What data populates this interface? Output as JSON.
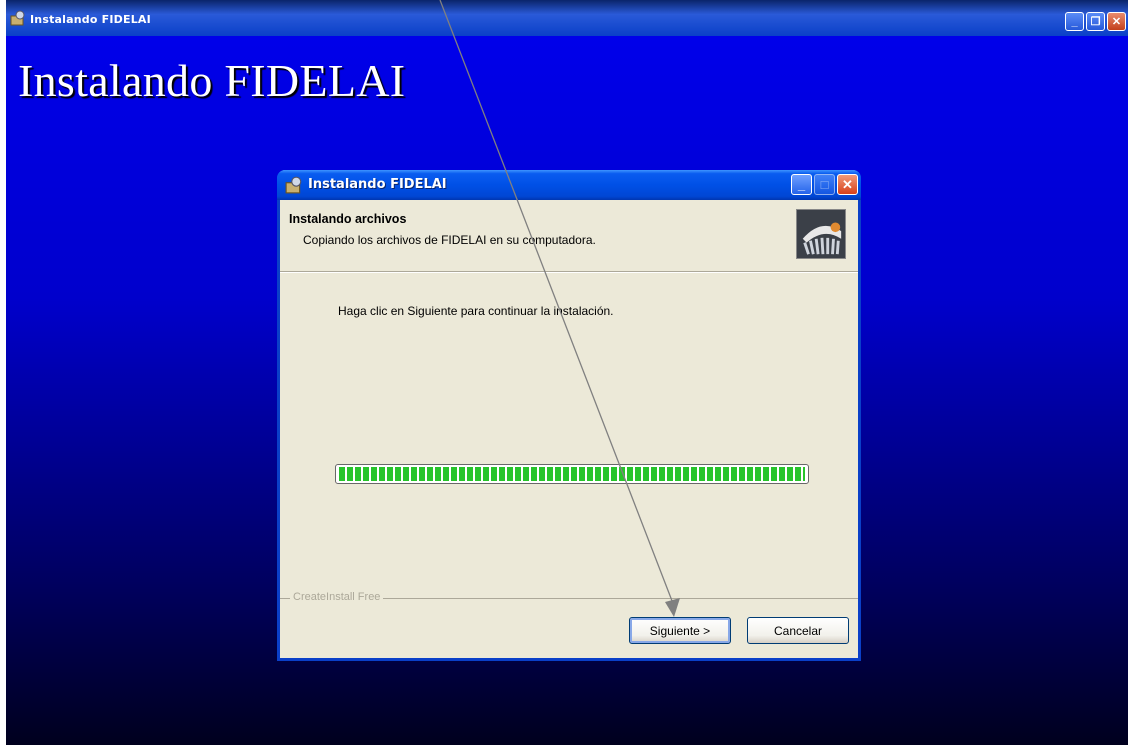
{
  "window": {
    "title": "Instalando FIDELAI",
    "banner": "Instalando FIDELAI",
    "controls": {
      "minimize": "_",
      "restore": "❐",
      "close": "✕"
    }
  },
  "dialog": {
    "title": "Instalando FIDELAI",
    "controls": {
      "minimize": "_",
      "maximize": "□",
      "close": "✕"
    },
    "header": {
      "title": "Instalando archivos",
      "subtitle": "Copiando los archivos de FIDELAI en su computadora."
    },
    "message": "Haga clic en Siguiente para continuar la instalación.",
    "progress": {
      "value_percent": 100
    },
    "branding": "CreateInstall Free",
    "buttons": {
      "next": "Siguiente >",
      "cancel": "Cancelar"
    }
  },
  "colors": {
    "desktop_top": "#0000ee",
    "desktop_bottom": "#00001e",
    "xp_title_blue": "#0050e6",
    "progress_green": "#27c42a",
    "dialog_face": "#ece9d8",
    "annotation_arrow": "#808080"
  },
  "icons": [
    "installer-app-icon",
    "minimize-icon",
    "restore-icon",
    "maximize-icon",
    "close-icon",
    "setup-logo-icon"
  ]
}
